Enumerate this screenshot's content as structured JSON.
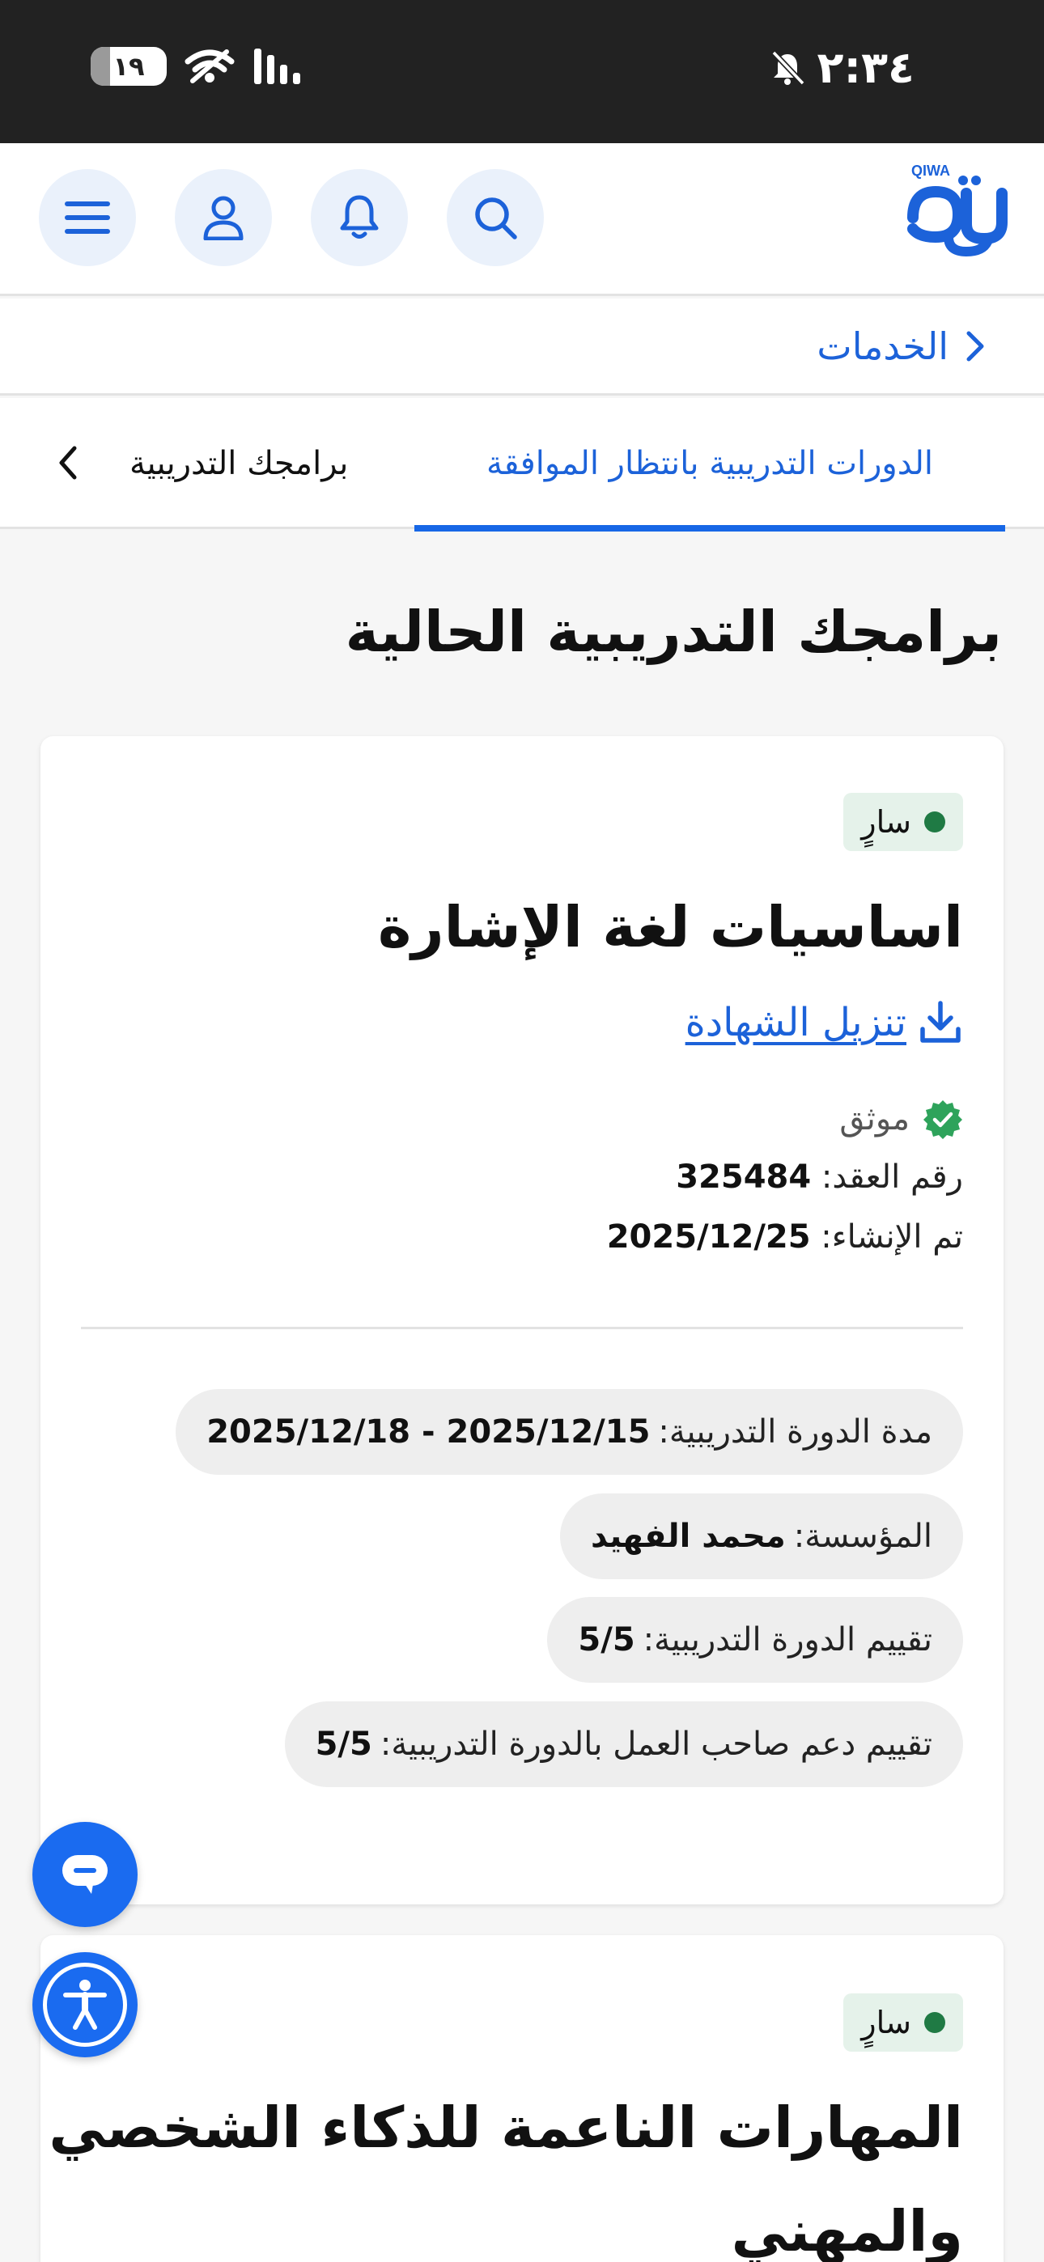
{
  "status_bar": {
    "time": "٢:٣٤",
    "battery_level": "١٩"
  },
  "header": {
    "logo_text": "QIWA",
    "icons": [
      "menu-icon",
      "user-icon",
      "bell-icon",
      "search-icon"
    ],
    "accent_color": "#1c62d9"
  },
  "breadcrumb": {
    "label": "الخدمات"
  },
  "tabs": {
    "active": "الدورات التدريبية بانتظار الموافقة",
    "inactive": "برامجك التدريبية"
  },
  "page_title": "برامجك التدريبية الحالية",
  "cards": [
    {
      "status": "سارٍ",
      "status_color": "#1f7a44",
      "title_lines": [
        "اساسيات لغة الإشارة"
      ],
      "download_label": "تنزيل الشهادة",
      "verified_label": "موثق",
      "contract_label": "رقم العقد: ",
      "contract_value": "325484",
      "created_label": "تم الإنشاء: ",
      "created_value": "2025/12/25",
      "duration_label": "مدة الدورة التدريبية: ",
      "duration_value": "2025/12/15 - 2025/12/18",
      "org_label": "المؤسسة: ",
      "org_value": "محمد الفهيد",
      "rating_label": "تقييم الدورة التدريبية: ",
      "rating_value": "5/5",
      "employer_rating_label": "تقييم دعم صاحب العمل بالدورة التدريبية: ",
      "employer_rating_value": "5/5"
    },
    {
      "status": "سارٍ",
      "status_color": "#1f7a44",
      "title_lines": [
        "المهارات الناعمة للذكاء الشخصي",
        "والمهني"
      ]
    }
  ]
}
